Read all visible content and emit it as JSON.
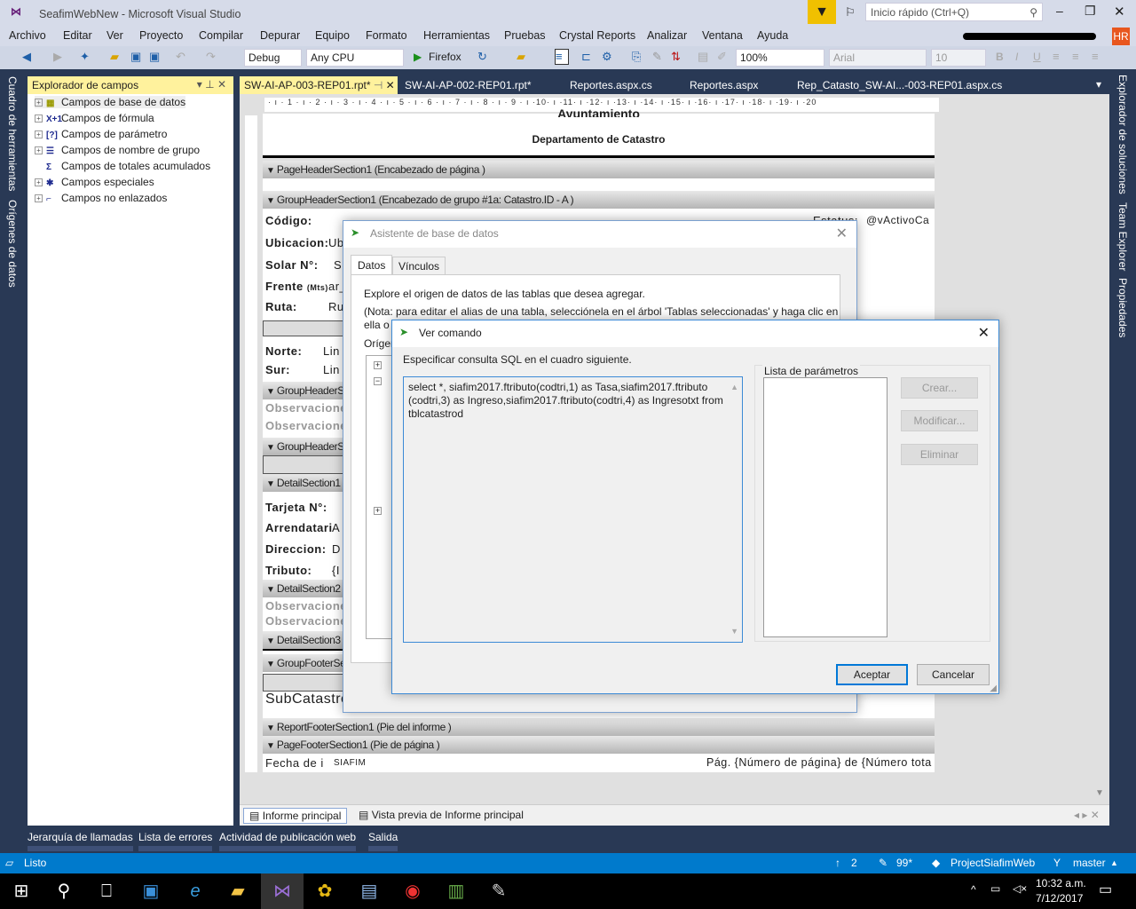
{
  "window": {
    "title": "SeafimWebNew - Microsoft Visual Studio",
    "quick_launch_placeholder": "Inicio rápido (Ctrl+Q)",
    "user_initials": "HR"
  },
  "menu": [
    "Archivo",
    "Editar",
    "Ver",
    "Proyecto",
    "Compilar",
    "Depurar",
    "Equipo",
    "Formato",
    "Herramientas",
    "Pruebas",
    "Crystal Reports",
    "Analizar",
    "Ventana",
    "Ayuda"
  ],
  "toolbar": {
    "config": "Debug",
    "platform": "Any CPU",
    "run_target": "Firefox",
    "zoom": "100%",
    "font": "Arial",
    "font_size": "10",
    "bold": "B",
    "italic": "I",
    "underline": "U"
  },
  "left_strip": [
    "Cuadro de herramientas",
    "Orígenes de datos"
  ],
  "right_strip": [
    "Explorador de soluciones",
    "Team Explorer",
    "Propiedades"
  ],
  "field_explorer": {
    "title": "Explorador de campos",
    "items": [
      "Campos de base de datos",
      "Campos de fórmula",
      "Campos de parámetro",
      "Campos de nombre de grupo",
      "Campos de totales acumulados",
      "Campos especiales",
      "Campos no enlazados"
    ],
    "icons": [
      "▦",
      "X+1",
      "[?]",
      "☰",
      "Σ",
      "✱",
      "⌐"
    ]
  },
  "doc_tabs": [
    "SW-AI-AP-003-REP01.rpt*",
    "SW-AI-AP-002-REP01.rpt*",
    "Reportes.aspx.cs",
    "Reportes.aspx",
    "Rep_Catasto_SW-AI...-003-REP01.aspx.cs"
  ],
  "ruler": "· ı · 1 · ı · 2 · ı · 3 · ı · 4 · ı · 5 · ı · 6 · ı · 7 · ı · 8 · ı · 9 · ı ·10· ı ·11· ı ·12· ı ·13· ı ·14· ı ·15· ı ·16· ı ·17· ı ·18· ı ·19· ı ·20",
  "report": {
    "header_title": "Ayuntamiento",
    "header_subtitle": "Departamento de Catastro",
    "sections": [
      "PageHeaderSection1 (Encabezado de página  )",
      "GroupHeaderSection1 (Encabezado de grupo #1a: Catastro.ID - A )",
      "GroupHeaderS",
      "GroupHeaderS",
      "DetailSection1",
      "DetailSection2",
      "DetailSection3",
      "GroupFooterSe",
      "ReportFooterSection1 (Pie del informe  )",
      "PageFooterSection1 (Pie de página  )"
    ],
    "labels": [
      "Código:",
      "Ubicacion:",
      "Solar N°:",
      "Frente",
      "Ruta:",
      "Norte:",
      "Sur:",
      "Tarjeta N°:",
      "Arrendatari",
      "Direccion:",
      "Tributo:"
    ],
    "frente_unit": "(Mts)",
    "fields": [
      "Ub",
      "S",
      "ar_",
      "Ru",
      "Lin",
      "Lin",
      "A",
      "D",
      "{I"
    ],
    "status_label": "Estatus:",
    "status_field": "@vActivoCa",
    "observ": [
      "Observacione",
      "Observaciones",
      "Observacione",
      "Observaciones"
    ],
    "subcatastro": "SubCatastro",
    "footer_fecha": "Fecha de i",
    "footer_siafim": "SIAFIM",
    "footer_page": "Pág. {Número de página} de {Número tota"
  },
  "bottom_tabs": [
    "Informe principal",
    "Vista previa de Informe principal"
  ],
  "tool_windows": [
    "Jerarquía de llamadas",
    "Lista de errores",
    "Actividad de publicación web",
    "Salida"
  ],
  "status": {
    "text": "Listo",
    "up": "2",
    "edits": "99*",
    "project": "ProjectSiafimWeb",
    "branch": "master"
  },
  "taskbar": {
    "time": "10:32 a.m.",
    "date": "7/12/2017"
  },
  "db_wizard": {
    "title": "Asistente de base de datos",
    "tabs": [
      "Datos",
      "Vínculos"
    ],
    "line1": "Explore el origen de datos de las tablas que desea agregar.",
    "line2": "(Nota: para editar el alias de una tabla, selecciónela en el árbol 'Tablas seleccionadas' y haga clic en",
    "line3": "ella o",
    "origin_label": "Orígen"
  },
  "ver_comando": {
    "title": "Ver comando",
    "instruction": "Especificar consulta SQL en el cuadro siguiente.",
    "sql": "select *, siafim2017.ftributo(codtri,1) as Tasa,siafim2017.ftributo (codtri,3) as Ingreso,siafim2017.ftributo(codtri,4) as Ingresotxt from tblcatastrod",
    "params_label": "Lista de parámetros",
    "create": "Crear...",
    "modify": "Modificar...",
    "delete": "Eliminar",
    "ok": "Aceptar",
    "cancel": "Cancelar"
  },
  "colors": {
    "accent": "#007acc",
    "tab_active": "#fff29d",
    "chrome": "#293955"
  }
}
